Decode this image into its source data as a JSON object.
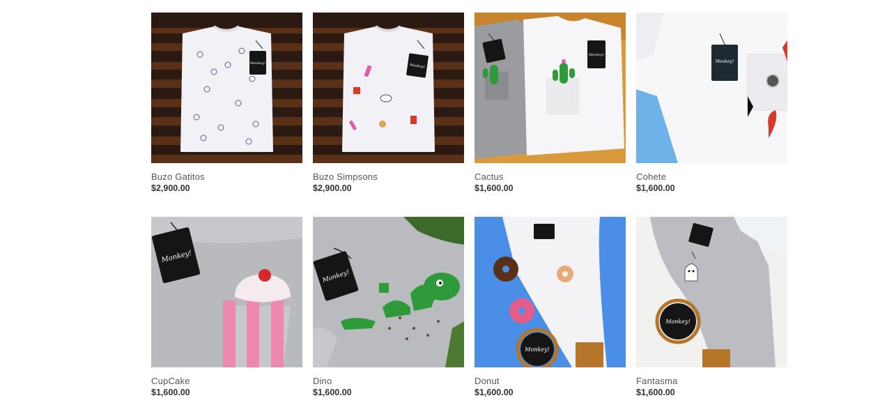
{
  "products": [
    {
      "name": "Buzo Gatitos",
      "price": "$2,900.00",
      "image": "white-sweatshirt-cats-on-wood"
    },
    {
      "name": "Buzo Simpsons",
      "price": "$2,900.00",
      "image": "white-sweatshirt-simpsons-on-wood"
    },
    {
      "name": "Cactus",
      "price": "$1,600.00",
      "image": "tshirts-cactus-pocket"
    },
    {
      "name": "Cohete",
      "price": "$1,600.00",
      "image": "white-tshirt-rocket-sky"
    },
    {
      "name": "CupCake",
      "price": "$1,600.00",
      "image": "grey-tshirt-cupcake"
    },
    {
      "name": "Dino",
      "price": "$1,600.00",
      "image": "grey-tshirt-dino"
    },
    {
      "name": "Donut",
      "price": "$1,600.00",
      "image": "white-tshirt-donuts-blue"
    },
    {
      "name": "Fantasma",
      "price": "$1,600.00",
      "image": "grey-tshirt-ghost"
    }
  ],
  "colors": {
    "wood_dark": "#3a2418",
    "wood_light": "#8a4a22",
    "sky_blue": "#6fb2ea",
    "grey_shirt": "#b9babd",
    "tag_black": "#151515"
  },
  "brand_tag_text": "Monkey!"
}
